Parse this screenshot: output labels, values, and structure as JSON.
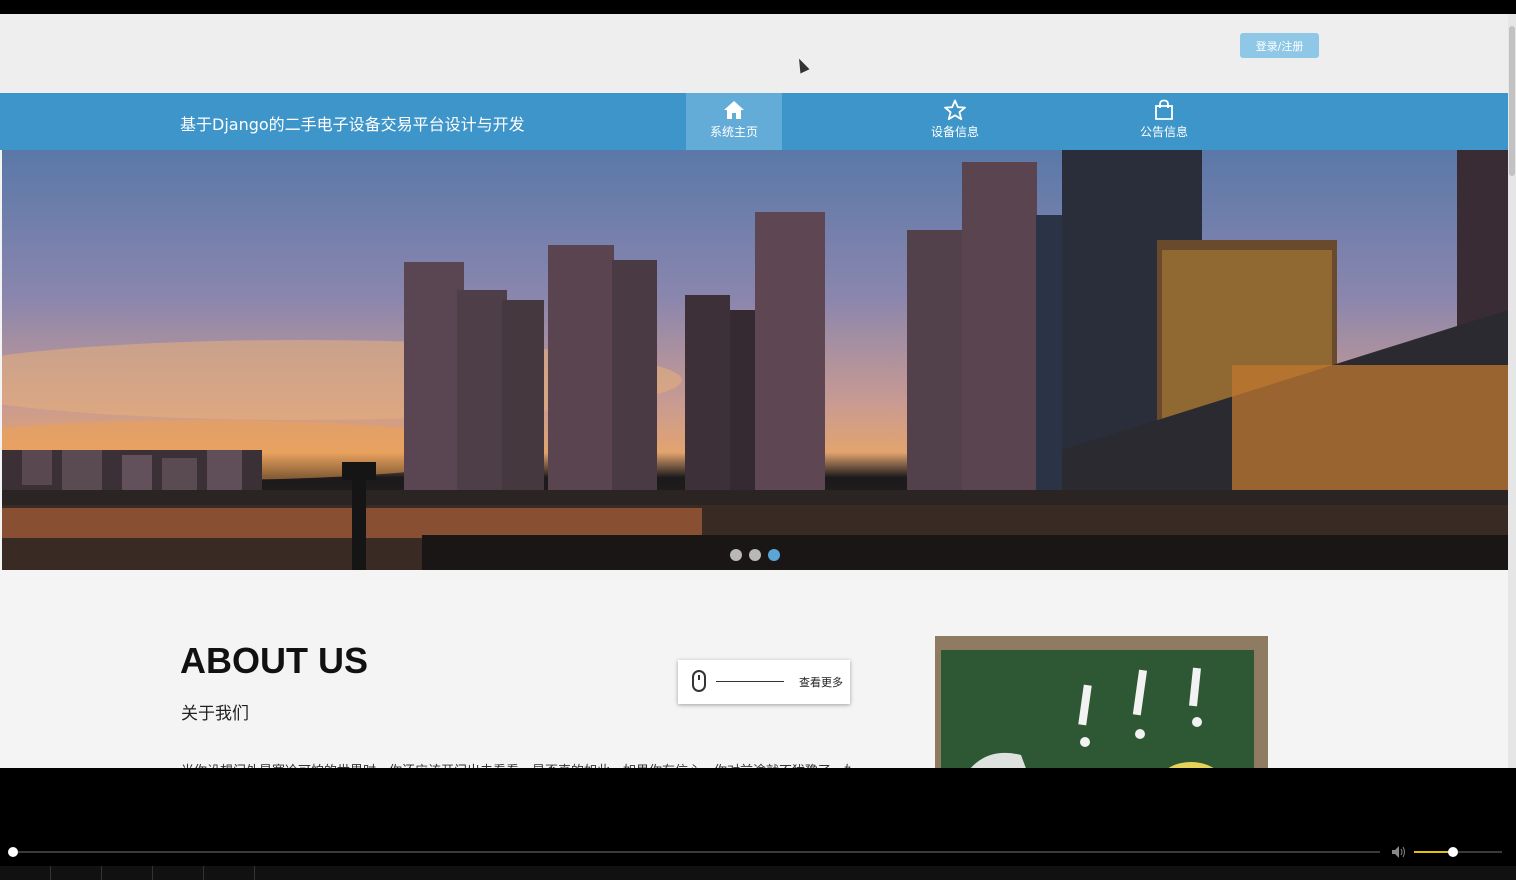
{
  "header": {
    "login_label": "登录/注册"
  },
  "nav": {
    "site_title": "基于Django的二手电子设备交易平台设计与开发",
    "items": [
      {
        "label": "系统主页",
        "icon": "home-icon",
        "active": true
      },
      {
        "label": "设备信息",
        "icon": "star-icon",
        "active": false
      },
      {
        "label": "公告信息",
        "icon": "bag-icon",
        "active": false
      }
    ]
  },
  "carousel": {
    "slides_count": 3,
    "active_index": 2
  },
  "about": {
    "title": "ABOUT US",
    "subtitle": "关于我们",
    "more_label": "查看更多",
    "text": "当你设想门外是寒冷可怕的世界时，你还应该开门出去看看，是否真的如此。如果你有信心，你对前途就不犹豫了。如"
  },
  "colors": {
    "nav": "#3d95c9",
    "nav_active": "#64acd8",
    "login": "#8fc8e6",
    "board": "#2e5834"
  },
  "player": {
    "progress": 0,
    "volume": 0.45
  }
}
